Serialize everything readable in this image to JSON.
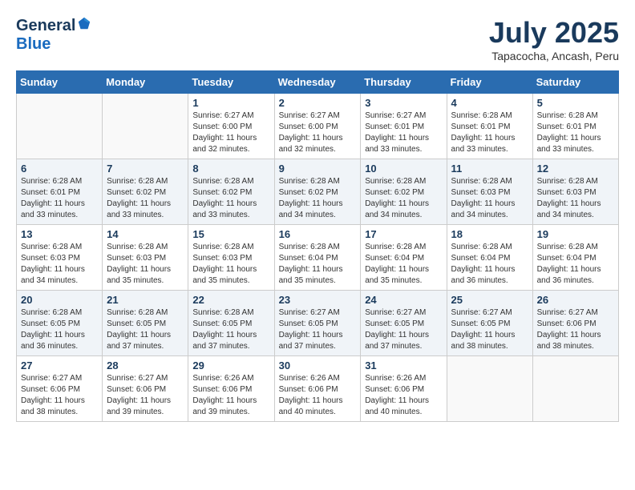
{
  "header": {
    "logo_general": "General",
    "logo_blue": "Blue",
    "month_title": "July 2025",
    "location": "Tapacocha, Ancash, Peru"
  },
  "days_of_week": [
    "Sunday",
    "Monday",
    "Tuesday",
    "Wednesday",
    "Thursday",
    "Friday",
    "Saturday"
  ],
  "weeks": [
    [
      {
        "day": "",
        "info": ""
      },
      {
        "day": "",
        "info": ""
      },
      {
        "day": "1",
        "info": "Sunrise: 6:27 AM\nSunset: 6:00 PM\nDaylight: 11 hours and 32 minutes."
      },
      {
        "day": "2",
        "info": "Sunrise: 6:27 AM\nSunset: 6:00 PM\nDaylight: 11 hours and 32 minutes."
      },
      {
        "day": "3",
        "info": "Sunrise: 6:27 AM\nSunset: 6:01 PM\nDaylight: 11 hours and 33 minutes."
      },
      {
        "day": "4",
        "info": "Sunrise: 6:28 AM\nSunset: 6:01 PM\nDaylight: 11 hours and 33 minutes."
      },
      {
        "day": "5",
        "info": "Sunrise: 6:28 AM\nSunset: 6:01 PM\nDaylight: 11 hours and 33 minutes."
      }
    ],
    [
      {
        "day": "6",
        "info": "Sunrise: 6:28 AM\nSunset: 6:01 PM\nDaylight: 11 hours and 33 minutes."
      },
      {
        "day": "7",
        "info": "Sunrise: 6:28 AM\nSunset: 6:02 PM\nDaylight: 11 hours and 33 minutes."
      },
      {
        "day": "8",
        "info": "Sunrise: 6:28 AM\nSunset: 6:02 PM\nDaylight: 11 hours and 33 minutes."
      },
      {
        "day": "9",
        "info": "Sunrise: 6:28 AM\nSunset: 6:02 PM\nDaylight: 11 hours and 34 minutes."
      },
      {
        "day": "10",
        "info": "Sunrise: 6:28 AM\nSunset: 6:02 PM\nDaylight: 11 hours and 34 minutes."
      },
      {
        "day": "11",
        "info": "Sunrise: 6:28 AM\nSunset: 6:03 PM\nDaylight: 11 hours and 34 minutes."
      },
      {
        "day": "12",
        "info": "Sunrise: 6:28 AM\nSunset: 6:03 PM\nDaylight: 11 hours and 34 minutes."
      }
    ],
    [
      {
        "day": "13",
        "info": "Sunrise: 6:28 AM\nSunset: 6:03 PM\nDaylight: 11 hours and 34 minutes."
      },
      {
        "day": "14",
        "info": "Sunrise: 6:28 AM\nSunset: 6:03 PM\nDaylight: 11 hours and 35 minutes."
      },
      {
        "day": "15",
        "info": "Sunrise: 6:28 AM\nSunset: 6:03 PM\nDaylight: 11 hours and 35 minutes."
      },
      {
        "day": "16",
        "info": "Sunrise: 6:28 AM\nSunset: 6:04 PM\nDaylight: 11 hours and 35 minutes."
      },
      {
        "day": "17",
        "info": "Sunrise: 6:28 AM\nSunset: 6:04 PM\nDaylight: 11 hours and 35 minutes."
      },
      {
        "day": "18",
        "info": "Sunrise: 6:28 AM\nSunset: 6:04 PM\nDaylight: 11 hours and 36 minutes."
      },
      {
        "day": "19",
        "info": "Sunrise: 6:28 AM\nSunset: 6:04 PM\nDaylight: 11 hours and 36 minutes."
      }
    ],
    [
      {
        "day": "20",
        "info": "Sunrise: 6:28 AM\nSunset: 6:05 PM\nDaylight: 11 hours and 36 minutes."
      },
      {
        "day": "21",
        "info": "Sunrise: 6:28 AM\nSunset: 6:05 PM\nDaylight: 11 hours and 37 minutes."
      },
      {
        "day": "22",
        "info": "Sunrise: 6:28 AM\nSunset: 6:05 PM\nDaylight: 11 hours and 37 minutes."
      },
      {
        "day": "23",
        "info": "Sunrise: 6:27 AM\nSunset: 6:05 PM\nDaylight: 11 hours and 37 minutes."
      },
      {
        "day": "24",
        "info": "Sunrise: 6:27 AM\nSunset: 6:05 PM\nDaylight: 11 hours and 37 minutes."
      },
      {
        "day": "25",
        "info": "Sunrise: 6:27 AM\nSunset: 6:05 PM\nDaylight: 11 hours and 38 minutes."
      },
      {
        "day": "26",
        "info": "Sunrise: 6:27 AM\nSunset: 6:06 PM\nDaylight: 11 hours and 38 minutes."
      }
    ],
    [
      {
        "day": "27",
        "info": "Sunrise: 6:27 AM\nSunset: 6:06 PM\nDaylight: 11 hours and 38 minutes."
      },
      {
        "day": "28",
        "info": "Sunrise: 6:27 AM\nSunset: 6:06 PM\nDaylight: 11 hours and 39 minutes."
      },
      {
        "day": "29",
        "info": "Sunrise: 6:26 AM\nSunset: 6:06 PM\nDaylight: 11 hours and 39 minutes."
      },
      {
        "day": "30",
        "info": "Sunrise: 6:26 AM\nSunset: 6:06 PM\nDaylight: 11 hours and 40 minutes."
      },
      {
        "day": "31",
        "info": "Sunrise: 6:26 AM\nSunset: 6:06 PM\nDaylight: 11 hours and 40 minutes."
      },
      {
        "day": "",
        "info": ""
      },
      {
        "day": "",
        "info": ""
      }
    ]
  ]
}
